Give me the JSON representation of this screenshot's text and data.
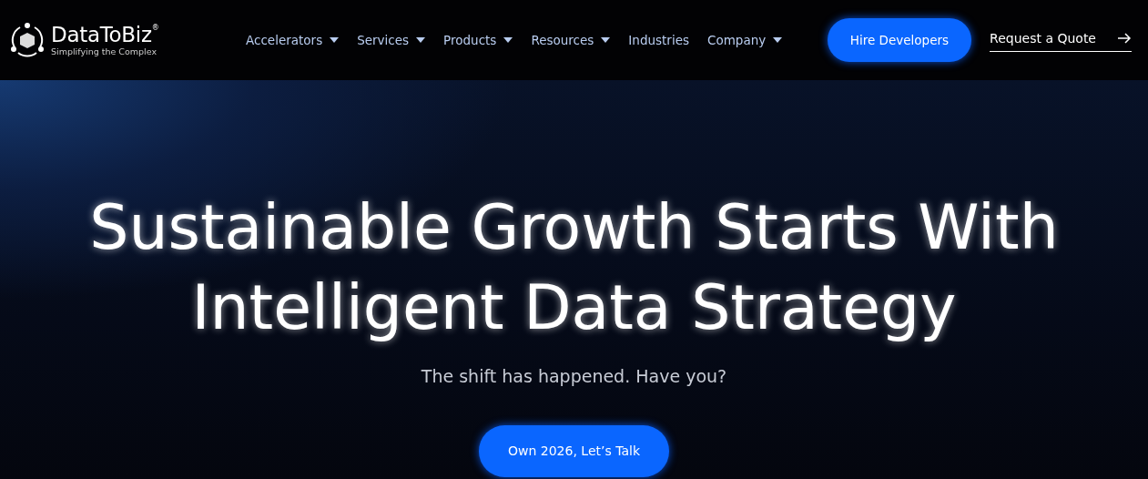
{
  "header": {
    "logo": {
      "name": "DataToBiz",
      "registered": "®",
      "tagline": "Simplifying the Complex"
    },
    "nav": [
      {
        "label": "Accelerators",
        "has_menu": true
      },
      {
        "label": "Services",
        "has_menu": true
      },
      {
        "label": "Products",
        "has_menu": true
      },
      {
        "label": "Resources",
        "has_menu": true
      },
      {
        "label": "Industries",
        "has_menu": false
      },
      {
        "label": "Company",
        "has_menu": true
      }
    ],
    "hire_button": "Hire Developers",
    "quote_link": "Request a Quote"
  },
  "hero": {
    "title": "Sustainable Growth Starts With Intelligent Data Strategy",
    "subtitle": "The shift has happened. Have you?",
    "cta": "Own 2026, Let’s Talk"
  }
}
